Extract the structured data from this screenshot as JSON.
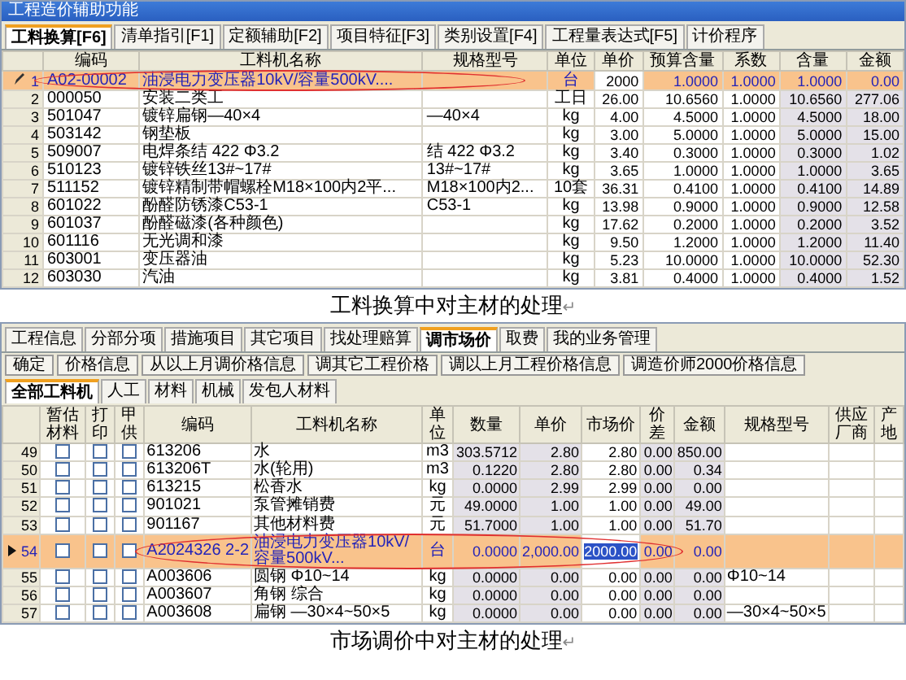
{
  "work_conversion": {
    "window_title": "工程造价辅助功能",
    "tabs": [
      {
        "label": "工料换算[F6]",
        "selected": true
      },
      {
        "label": "清单指引[F1]",
        "selected": false
      },
      {
        "label": "定额辅助[F2]",
        "selected": false
      },
      {
        "label": "项目特征[F3]",
        "selected": false
      },
      {
        "label": "类别设置[F4]",
        "selected": false
      },
      {
        "label": "工程量表达式[F5]",
        "selected": false
      },
      {
        "label": "计价程序",
        "selected": false
      }
    ],
    "columns": [
      {
        "label": "编码",
        "kind": "text"
      },
      {
        "label": "工料机名称",
        "kind": "text"
      },
      {
        "label": "规格型号",
        "kind": "text"
      },
      {
        "label": "单位",
        "kind": "center"
      },
      {
        "label": "单价",
        "kind": "input"
      },
      {
        "label": "预算含量",
        "kind": "num"
      },
      {
        "label": "系数",
        "kind": "num"
      },
      {
        "label": "含量",
        "kind": "calc"
      },
      {
        "label": "金额",
        "kind": "calc"
      }
    ],
    "rows": [
      {
        "number": "1",
        "editing": true,
        "selected": true,
        "circled": true,
        "cells": [
          "A02-00002",
          "油浸电力变压器10kV/容量500kV....",
          null,
          "台",
          "2000",
          "1.0000",
          "1.0000",
          "1.0000",
          "0.00"
        ]
      },
      {
        "number": "2",
        "selected": false,
        "circled": false,
        "cells": [
          "000050",
          "安装二类工",
          null,
          "工日",
          "26.00",
          "10.6560",
          "1.0000",
          "10.6560",
          "277.06"
        ]
      },
      {
        "number": "3",
        "selected": false,
        "circled": false,
        "cells": [
          "501047",
          "镀锌扁钢—40×4",
          "—40×4",
          "kg",
          "4.00",
          "4.5000",
          "1.0000",
          "4.5000",
          "18.00"
        ]
      },
      {
        "number": "4",
        "selected": false,
        "circled": false,
        "cells": [
          "503142",
          "钢垫板",
          null,
          "kg",
          "3.00",
          "5.0000",
          "1.0000",
          "5.0000",
          "15.00"
        ]
      },
      {
        "number": "5",
        "selected": false,
        "circled": false,
        "cells": [
          "509007",
          "电焊条结 422 Φ3.2",
          "结 422 Φ3.2",
          "kg",
          "3.40",
          "0.3000",
          "1.0000",
          "0.3000",
          "1.02"
        ]
      },
      {
        "number": "6",
        "selected": false,
        "circled": false,
        "cells": [
          "510123",
          "镀锌铁丝13#~17#",
          "13#~17#",
          "kg",
          "3.65",
          "1.0000",
          "1.0000",
          "1.0000",
          "3.65"
        ]
      },
      {
        "number": "7",
        "selected": false,
        "circled": false,
        "cells": [
          "511152",
          "镀锌精制带帽螺栓M18×100内2平...",
          "M18×100内2...",
          "10套",
          "36.31",
          "0.4100",
          "1.0000",
          "0.4100",
          "14.89"
        ]
      },
      {
        "number": "8",
        "selected": false,
        "circled": false,
        "cells": [
          "601022",
          "酚醛防锈漆C53-1",
          "C53-1",
          "kg",
          "13.98",
          "0.9000",
          "1.0000",
          "0.9000",
          "12.58"
        ]
      },
      {
        "number": "9",
        "selected": false,
        "circled": false,
        "cells": [
          "601037",
          "酚醛磁漆(各种颜色)",
          null,
          "kg",
          "17.62",
          "0.2000",
          "1.0000",
          "0.2000",
          "3.52"
        ]
      },
      {
        "number": "10",
        "selected": false,
        "circled": false,
        "cells": [
          "601116",
          "无光调和漆",
          null,
          "kg",
          "9.50",
          "1.2000",
          "1.0000",
          "1.2000",
          "11.40"
        ]
      },
      {
        "number": "11",
        "selected": false,
        "circled": false,
        "cells": [
          "603001",
          "变压器油",
          null,
          "kg",
          "5.23",
          "10.0000",
          "1.0000",
          "10.0000",
          "52.30"
        ]
      },
      {
        "number": "12",
        "selected": false,
        "circled": false,
        "cells": [
          "603030",
          "汽油",
          null,
          "kg",
          "3.81",
          "0.4000",
          "1.0000",
          "0.4000",
          "1.52"
        ]
      }
    ]
  },
  "caption_1": {
    "text": "工料换算中对主材的处理",
    "end_mark": "↵"
  },
  "market_adjust": {
    "tabs": [
      {
        "label": "工程信息",
        "selected": false
      },
      {
        "label": "分部分项",
        "selected": false
      },
      {
        "label": "措施项目",
        "selected": false
      },
      {
        "label": "其它项目",
        "selected": false
      },
      {
        "label": "找处理赔算",
        "selected": false
      },
      {
        "label": "调市场价",
        "selected": true
      },
      {
        "label": "取费",
        "selected": false
      },
      {
        "label": "我的业务管理",
        "selected": false
      }
    ],
    "buttons": [
      "确定",
      "价格信息",
      "从以上月调价格信息",
      "调其它工程价格",
      "调以上月工程价格信息",
      "调造价师2000价格信息"
    ],
    "subtabs": [
      {
        "label": "全部工料机",
        "selected": true
      },
      {
        "label": "人工",
        "selected": false
      },
      {
        "label": "材料",
        "selected": false
      },
      {
        "label": "机械",
        "selected": false
      },
      {
        "label": "发包人材料",
        "selected": false
      }
    ],
    "columns": [
      {
        "label": "暂估材料",
        "kind": "check"
      },
      {
        "label": "打印",
        "kind": "check"
      },
      {
        "label": "甲供",
        "kind": "check"
      },
      {
        "label": "编码",
        "kind": "text"
      },
      {
        "label": "工料机名称",
        "kind": "text"
      },
      {
        "label": "单位",
        "kind": "center"
      },
      {
        "label": "数量",
        "kind": "calc"
      },
      {
        "label": "单价",
        "kind": "calc"
      },
      {
        "label": "市场价",
        "kind": "input"
      },
      {
        "label": "价差",
        "kind": "calc"
      },
      {
        "label": "金额",
        "kind": "calc"
      },
      {
        "label": "规格型号",
        "kind": "text"
      },
      {
        "label": "供应厂商",
        "kind": "text"
      },
      {
        "label": "产地",
        "kind": "text"
      }
    ],
    "rows": [
      {
        "number": "49",
        "selected": false,
        "circled": false,
        "cells": [
          false,
          false,
          false,
          "613206",
          "水",
          "m3",
          "303.5712",
          "2.80",
          "2.80",
          "0.00",
          "850.00",
          null,
          null,
          null
        ]
      },
      {
        "number": "50",
        "selected": false,
        "circled": false,
        "cells": [
          false,
          false,
          false,
          "613206T",
          "水(轮用)",
          "m3",
          "0.1220",
          "2.80",
          "2.80",
          "0.00",
          "0.34",
          null,
          null,
          null
        ]
      },
      {
        "number": "51",
        "selected": false,
        "circled": false,
        "cells": [
          false,
          false,
          false,
          "613215",
          "松香水",
          "kg",
          "0.0000",
          "2.99",
          "2.99",
          "0.00",
          "0.00",
          null,
          null,
          null
        ]
      },
      {
        "number": "52",
        "selected": false,
        "circled": false,
        "cells": [
          false,
          false,
          false,
          "901021",
          "泵管摊销费",
          "元",
          "49.0000",
          "1.00",
          "1.00",
          "0.00",
          "49.00",
          null,
          null,
          null
        ]
      },
      {
        "number": "53",
        "selected": false,
        "circled": false,
        "cells": [
          false,
          false,
          false,
          "901167",
          "其他材料费",
          "元",
          "51.7000",
          "1.00",
          "1.00",
          "0.00",
          "51.70",
          null,
          null,
          null
        ]
      },
      {
        "number": "54",
        "current": true,
        "selected": true,
        "circled": true,
        "cells": [
          false,
          false,
          false,
          "A2024326 2-2",
          "油浸电力变压器10kV/容量500kV...",
          "台",
          "0.0000",
          "2,000.00",
          "2000.00",
          "0.00",
          "0.00",
          null,
          null,
          null
        ]
      },
      {
        "number": "55",
        "selected": false,
        "circled": false,
        "cells": [
          false,
          false,
          false,
          "A003606",
          "圆钢 Φ10~14",
          "kg",
          "0.0000",
          "0.00",
          "0.00",
          "0.00",
          "0.00",
          "Φ10~14",
          null,
          null
        ]
      },
      {
        "number": "56",
        "selected": false,
        "circled": false,
        "cells": [
          false,
          false,
          false,
          "A003607",
          "角钢 综合",
          "kg",
          "0.0000",
          "0.00",
          "0.00",
          "0.00",
          "0.00",
          null,
          null,
          null
        ]
      },
      {
        "number": "57",
        "selected": false,
        "circled": false,
        "cells": [
          false,
          false,
          false,
          "A003608",
          "扁钢 —30×4~50×5",
          "kg",
          "0.0000",
          "0.00",
          "0.00",
          "0.00",
          "0.00",
          "—30×4~50×5",
          null,
          null
        ]
      }
    ]
  },
  "caption_2": {
    "text": "市场调价中对主材的处理",
    "end_mark": "↵"
  }
}
